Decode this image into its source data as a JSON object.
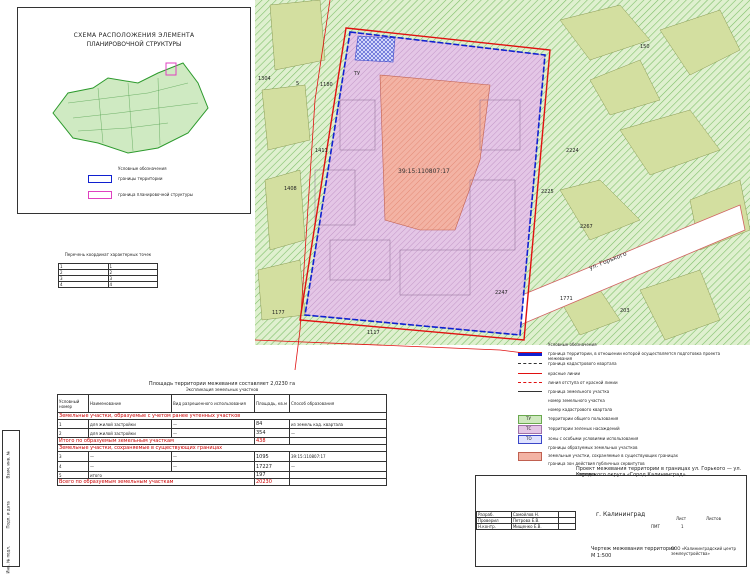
{
  "inset": {
    "title_line1": "СХЕМА РАСПОЛОЖЕНИЯ ЭЛЕМЕНТА",
    "title_line2": "ПЛАНИРОВОЧНОЙ СТРУКТУРЫ",
    "legend_title": "Условные обозначения",
    "legend_blue": "границы территории",
    "legend_magenta": "граница планировочной структуры"
  },
  "map": {
    "cadastral_center": "39:15:110807:17",
    "zone_small_label": "ТУ",
    "street_label": "ул. Горького",
    "numbers": [
      "150",
      "1304",
      "1411",
      "1408",
      "1180",
      "1117",
      "1177",
      "2224",
      "2225",
      "2247",
      "1771",
      "2267",
      "203",
      "5"
    ],
    "colors": {
      "pink_zone": "#dcb4dc",
      "salmon_zone": "#f4a090",
      "green_hatch": "#c8e6b4",
      "olive_block": "#d7e3a8",
      "boundary_blue": "#1020d0",
      "boundary_red": "#e01010"
    }
  },
  "plots_small_table": {
    "title": "Перечень координат характерных точек",
    "rows": [
      [
        "1",
        "1"
      ],
      [
        "2",
        "2"
      ],
      [
        "3",
        "3"
      ],
      [
        "4",
        "4"
      ]
    ]
  },
  "plots_table": {
    "title": "Площадь территории межевания составляет 2,0230 га",
    "subtitle": "Экспликация земельных участков",
    "headers": [
      "Условный номер",
      "Наименование",
      "Вид разрешенного использования",
      "Площадь, кв.м",
      "Способ образования"
    ],
    "section1": "Земельные участки, образуемые с учетом ранее учтенных участков",
    "row1": [
      "1",
      "для жилой застройки",
      "—",
      "84",
      "из земель кад. квартала"
    ],
    "row2": [
      "2",
      "для жилой застройки",
      "—",
      "354",
      "—"
    ],
    "subtotal1_label": "Итого по образуемым земельным участкам",
    "subtotal1_value": "438",
    "section2": "Земельные участки, сохраняемые в существующих границах",
    "row3": [
      "3",
      "—",
      "—",
      "1095",
      "39:15:110807:17"
    ],
    "row4": [
      "4",
      "—",
      "—",
      "17227",
      "—"
    ],
    "row5": [
      "5",
      "итого",
      "",
      "197",
      ""
    ],
    "total_label": "Всего по образуемым земельным участкам",
    "total_value": "20230"
  },
  "legend": {
    "items": [
      "Условные обозначения",
      "граница территории, в отношении которой осуществляется подготовка проекта межевания",
      "граница кадастрового квартала",
      "красные линии",
      "линия отступа от красной линии",
      "граница земельного участка",
      "номер земельного участка",
      "номер кадастрового квартала",
      "территории общего пользования",
      "территории зеленых насаждений",
      "зоны с особыми условиями использования",
      "границы образуемых земельных участков",
      "земельные участки, сохраняемые в существующих границах",
      "граница зон действия публичных сервитутов"
    ],
    "swatch_labels": [
      "ТУ",
      "ТС",
      "ТО"
    ]
  },
  "title_block": {
    "project_title": "Проект межевания территории в границах ул. Горького — ул. Кирова",
    "project_subtitle": "городского округа «Город Калининград»",
    "city": "г. Калининград",
    "drawing_title": "Чертеж межевания территории",
    "scale": "М 1:500",
    "sheet_label": "Лист",
    "sheets_label": "Листов",
    "sheet_value": "1",
    "stage": "ПМТ",
    "people": [
      [
        "Разраб.",
        "Самойлов Н.",
        "",
        ""
      ],
      [
        "Проверил",
        "Петрова Е.В.",
        "",
        ""
      ],
      [
        "Н.контр.",
        "Мищенко Е.В.",
        "",
        ""
      ]
    ],
    "org": "ООО «Калининградский центр землеустройства»"
  },
  "side_stamp": {
    "labels": [
      "Инв. № подл.",
      "Подп. и дата",
      "Взам. инв. №"
    ]
  }
}
